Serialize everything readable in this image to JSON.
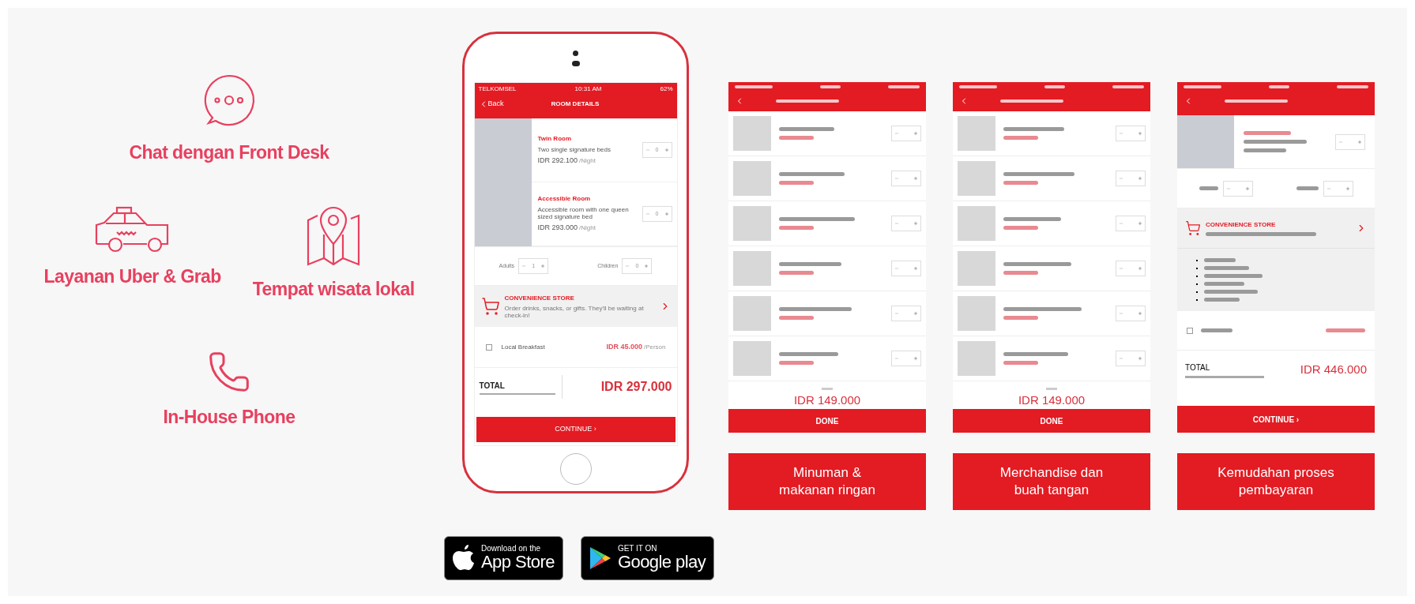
{
  "features": [
    {
      "kind": "chat",
      "label": "Chat dengan Front Desk"
    },
    {
      "kind": "taxi",
      "label": "Layanan Uber & Grab"
    },
    {
      "kind": "map",
      "label": "Tempat wisata lokal"
    },
    {
      "kind": "phone",
      "label": "In-House Phone"
    }
  ],
  "phone": {
    "status": {
      "carrier": "TELKOMSEL",
      "time": "10:31 AM",
      "battery": "62%"
    },
    "back": "Back",
    "title": "ROOM DETAILS",
    "rooms": [
      {
        "name": "Twin Room",
        "desc": "Two single signature beds",
        "price": "IDR 292.100",
        "unit": "/Night",
        "qty": "0"
      },
      {
        "name": "Accessible Room",
        "desc": "Accessible room with one queen sized signature bed",
        "price": "IDR 293.000",
        "unit": "/Night",
        "qty": "0"
      }
    ],
    "guests": [
      {
        "label": "Adults",
        "value": "1"
      },
      {
        "label": "Children",
        "value": "0"
      }
    ],
    "store": {
      "title": "CONVENIENCE STORE",
      "subtitle": "Order drinks, snacks, or gifts. They'll be waiting at check-in!"
    },
    "addon": {
      "label": "Local Breakfast",
      "checked": false,
      "price": "IDR 45.000",
      "unit": "/Person"
    },
    "total": {
      "label": "TOTAL",
      "price": "IDR 297.000"
    },
    "button": "CONTINUE ›"
  },
  "screens": [
    {
      "kind": "list",
      "total": "IDR 149.000",
      "button": "DONE",
      "caption": "Minuman &\nmakanan ringan"
    },
    {
      "kind": "list",
      "total": "IDR 149.000",
      "button": "DONE",
      "caption": "Merchandise dan\nbuah tangan"
    },
    {
      "kind": "checkout",
      "store": "CONVENIENCE STORE",
      "addon_checked": false,
      "total_label": "TOTAL",
      "total": "IDR 446.000",
      "button": "CONTINUE ›",
      "caption": "Kemudahan proses\npembayaran"
    }
  ],
  "badges": [
    {
      "kind": "apple",
      "small": "Download on the",
      "big": "App Store"
    },
    {
      "kind": "google",
      "small": "GET IT ON",
      "big": "Google play"
    }
  ]
}
